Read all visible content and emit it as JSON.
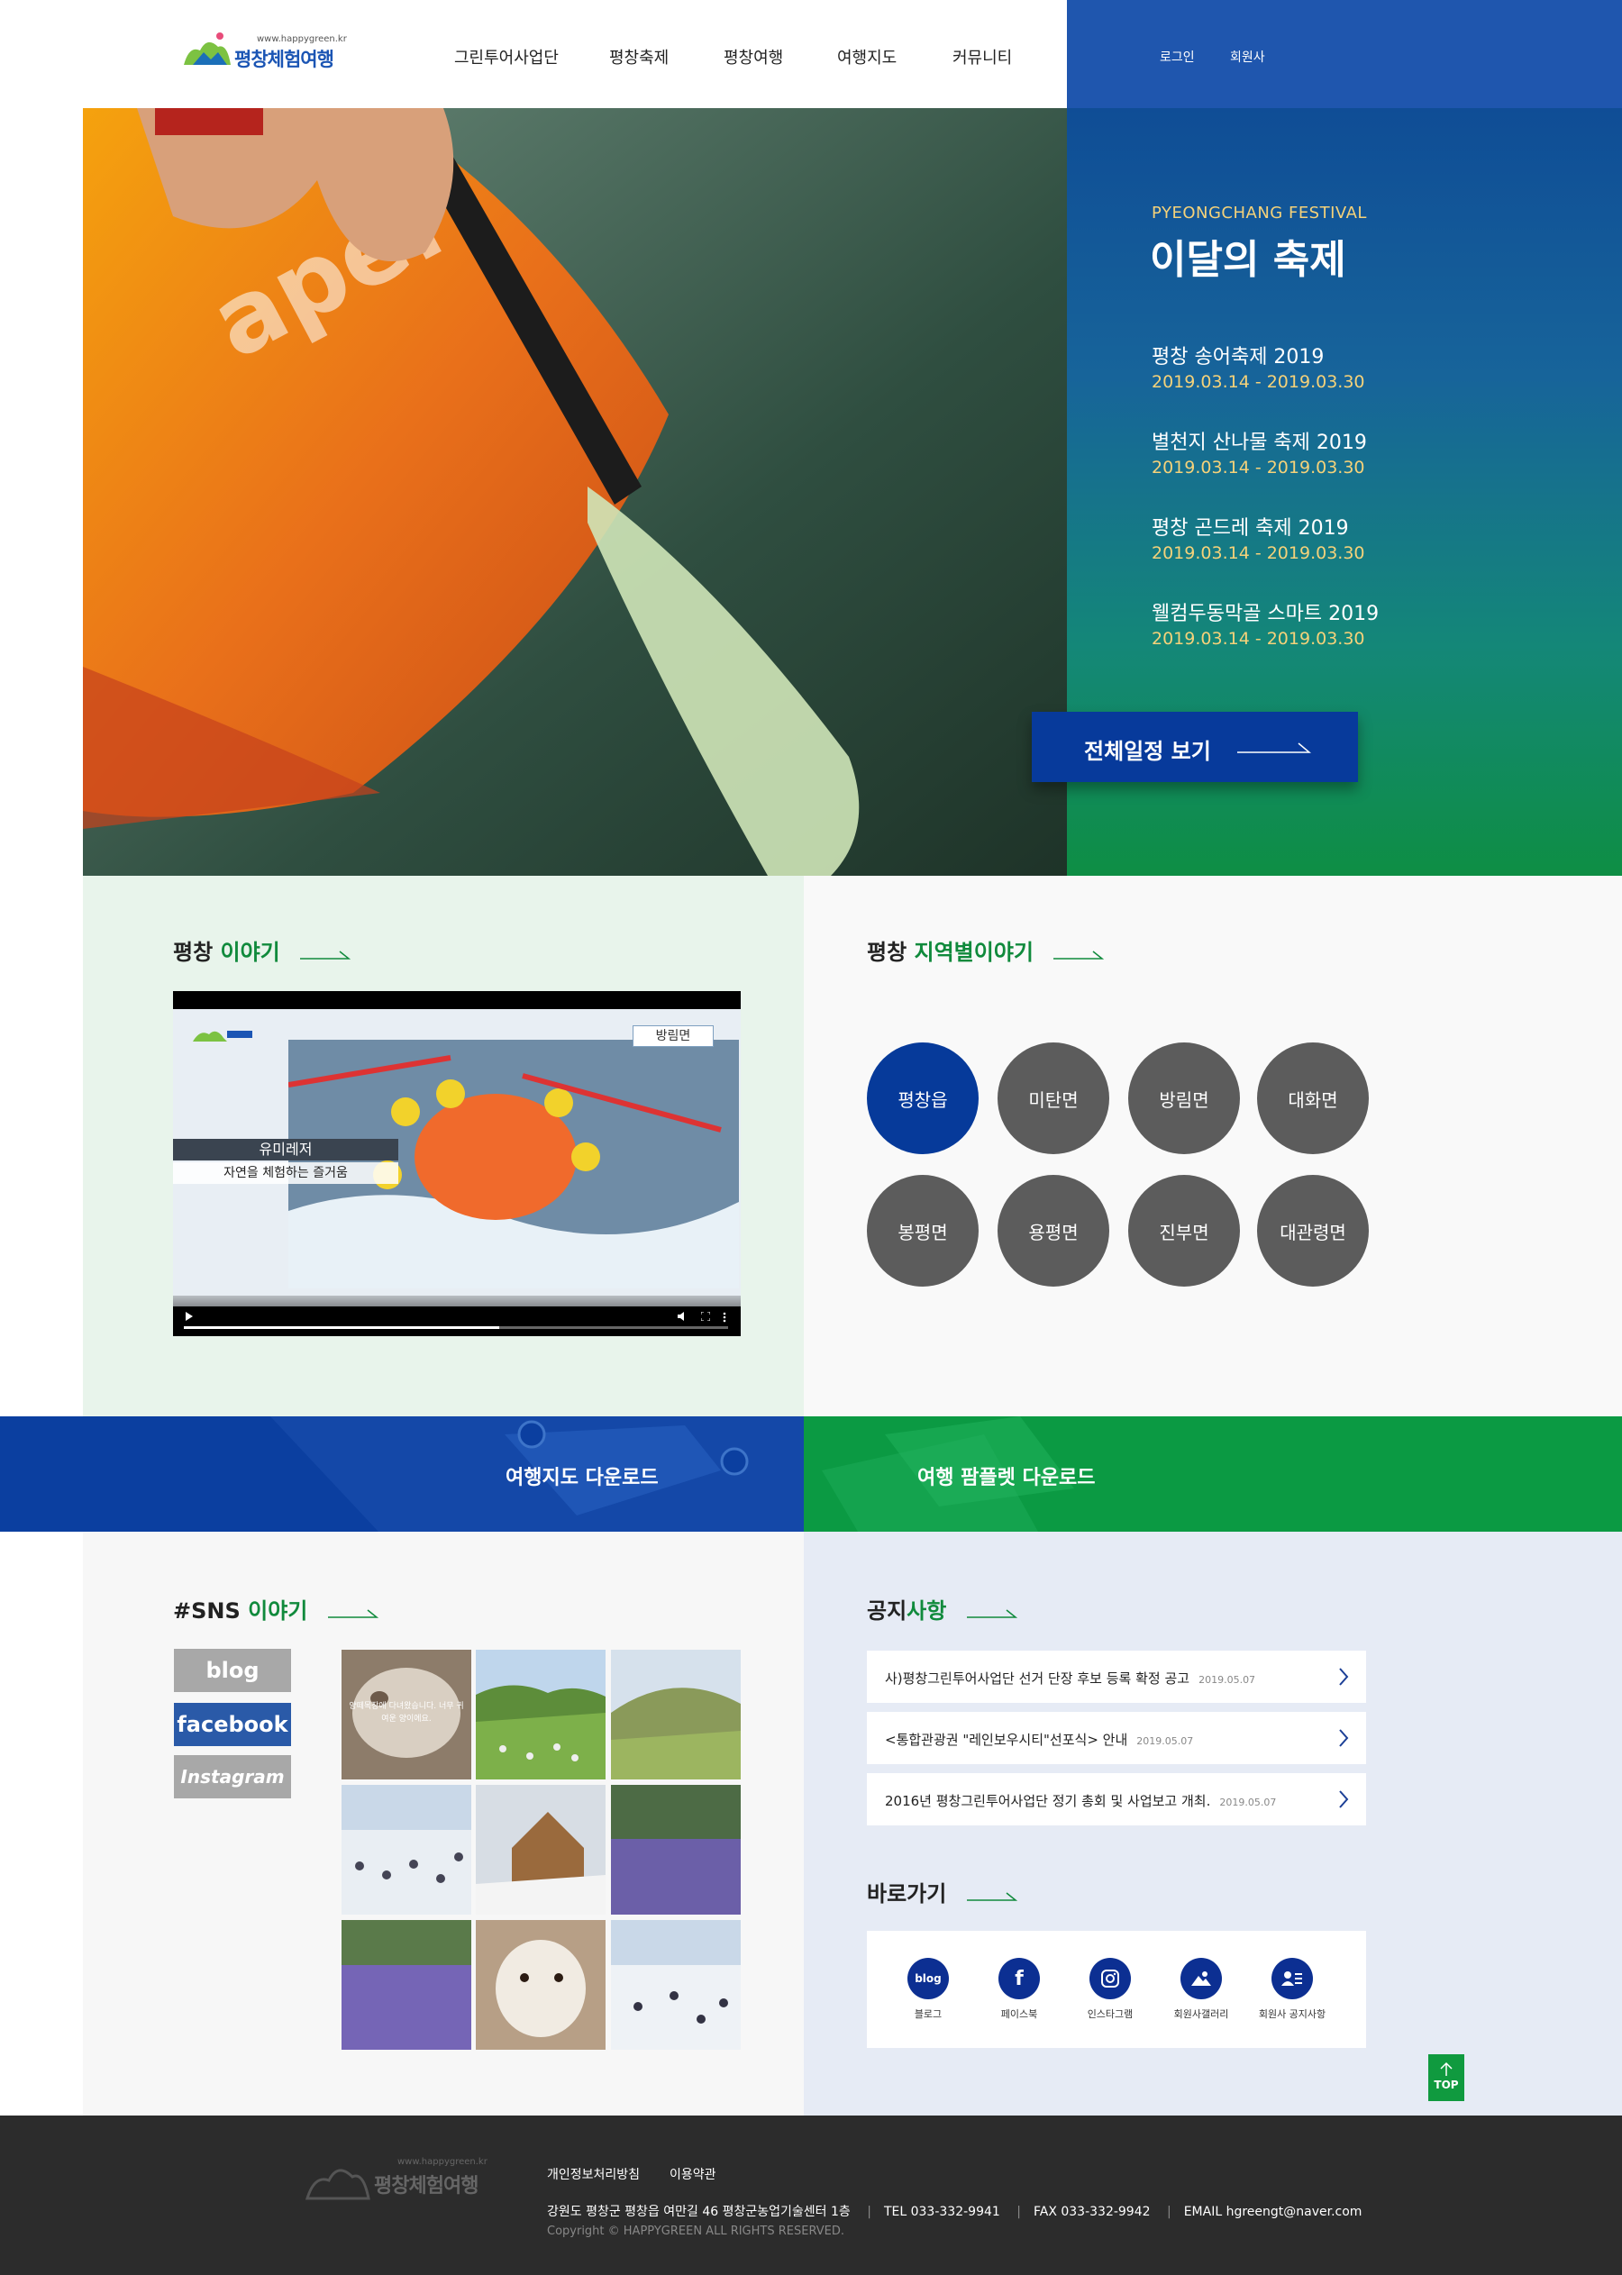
{
  "header": {
    "logo_url": "www.happygreen.kr",
    "logo_name": "평창체험여행",
    "nav": [
      "그린투어사업단",
      "평창축제",
      "평창여행",
      "여행지도",
      "커뮤니티"
    ],
    "util": {
      "login": "로그인",
      "member": "회원사"
    }
  },
  "festival": {
    "subtitle": "PYEONGCHANG FESTIVAL",
    "title": "이달의 축제",
    "events": [
      {
        "name": "평창 송어축제 2019",
        "date": "2019.03.14 - 2019.03.30"
      },
      {
        "name": "별천지 산나물 축제 2019",
        "date": "2019.03.14 - 2019.03.30"
      },
      {
        "name": "평창 곤드레 축제 2019",
        "date": "2019.03.14 - 2019.03.30"
      },
      {
        "name": "웰컴두동막골 스마트 2019",
        "date": "2019.03.14 - 2019.03.30"
      }
    ],
    "button": "전체일정 보기"
  },
  "story": {
    "title_a": "평창 ",
    "title_b": "이야기",
    "video": {
      "badge": "방림면",
      "caption_title": "유미레저",
      "caption_sub": "자연을 체험하는 즐거움",
      "progress": 0.58
    }
  },
  "region": {
    "title_a": "평창 ",
    "title_b": "지역별이야기",
    "items": [
      "평창읍",
      "미탄면",
      "방림면",
      "대화면",
      "봉평면",
      "용평면",
      "진부면",
      "대관령면"
    ],
    "active": "평창읍"
  },
  "banners": {
    "map": "여행지도 다운로드",
    "pamphlet": "여행 팜플렛 다운로드"
  },
  "sns": {
    "title_a": "#SNS ",
    "title_b": "이야기",
    "buttons": [
      "blog",
      "facebook",
      "Instagram"
    ],
    "photo_caption": "양떼목장에 다녀왔습니다. 너무 귀여운 양이에요."
  },
  "notice": {
    "title_a": "공지",
    "title_b": "사항",
    "items": [
      {
        "text": "사)평창그린투어사업단 선거 단장 후보 등록 확정 공고",
        "date": "2019.05.07"
      },
      {
        "text": "<통합관광권 \"레인보우시티\"선포식> 안내",
        "date": "2019.05.07"
      },
      {
        "text": "2016년 평창그린투어사업단 정기 총회 및 사업보고 개최.",
        "date": "2019.05.07"
      }
    ]
  },
  "quick": {
    "title": "바로가기",
    "items": [
      {
        "label": "블로그",
        "icon": "blog-icon",
        "glyph": "blog"
      },
      {
        "label": "페이스북",
        "icon": "facebook-icon",
        "glyph": "f"
      },
      {
        "label": "인스타그램",
        "icon": "instagram-icon",
        "glyph": ""
      },
      {
        "label": "회원사갤러리",
        "icon": "gallery-icon",
        "glyph": ""
      },
      {
        "label": "회원사 공지사항",
        "icon": "member-notice-icon",
        "glyph": ""
      }
    ]
  },
  "top_button": "TOP",
  "footer": {
    "logo_url": "www.happygreen.kr",
    "logo_name": "평창체험여행",
    "links": [
      "개인정보처리방침",
      "이용약관"
    ],
    "address": "강원도 평창군 평창읍 여만길 46 평창군농업기술센터 1층",
    "tel": "TEL 033-332-9941",
    "fax": "FAX 033-332-9942",
    "email": "EMAIL hgreengt@naver.com",
    "copyright": "Copyright © HAPPYGREEN ALL RIGHTS RESERVED."
  },
  "colors": {
    "brand_blue": "#1f56ae",
    "brand_green": "#108a3c",
    "accent_yellow": "#f5d27a"
  }
}
